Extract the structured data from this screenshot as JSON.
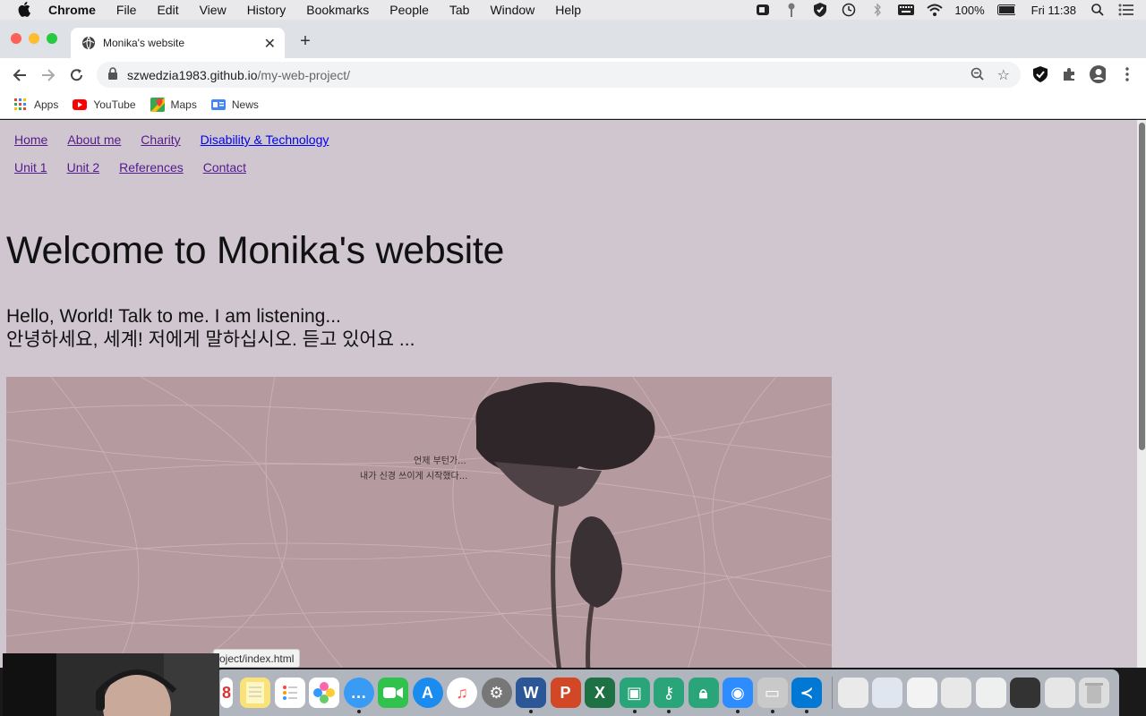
{
  "menubar": {
    "app": "Chrome",
    "items": [
      "File",
      "Edit",
      "View",
      "History",
      "Bookmarks",
      "People",
      "Tab",
      "Window",
      "Help"
    ],
    "battery": "100%",
    "clock": "Fri 11:38"
  },
  "tab": {
    "title": "Monika's website"
  },
  "address": {
    "host": "szwedzia1983.github.io",
    "path": "/my-web-project/"
  },
  "bookmarks": [
    {
      "label": "Apps",
      "icon": "apps-grid-icon"
    },
    {
      "label": "YouTube",
      "icon": "youtube-icon"
    },
    {
      "label": "Maps",
      "icon": "maps-icon"
    },
    {
      "label": "News",
      "icon": "news-icon"
    }
  ],
  "page": {
    "nav_row1": [
      "Home",
      "About me",
      "Charity",
      "Disability & Technology"
    ],
    "nav_row2": [
      "Unit 1",
      "Unit 2",
      "References",
      "Contact"
    ],
    "title": "Welcome to Monika's website",
    "greeting_en": "Hello, World! Talk to me. I am listening...",
    "greeting_ko": "안녕하세요, 세계! 저에게 말하십시오. 듣고 있어요 ...",
    "image_caption_line1": "언제 부턴가...",
    "image_caption_line2": "내가 신경 쓰이게 시작했다..."
  },
  "status_url": "oject/index.html",
  "colors": {
    "page_bg": "#cfc6cf",
    "link_visited": "#551a8b",
    "link_unvisited": "#0000ee",
    "hero_bg": "#b59ba0"
  }
}
